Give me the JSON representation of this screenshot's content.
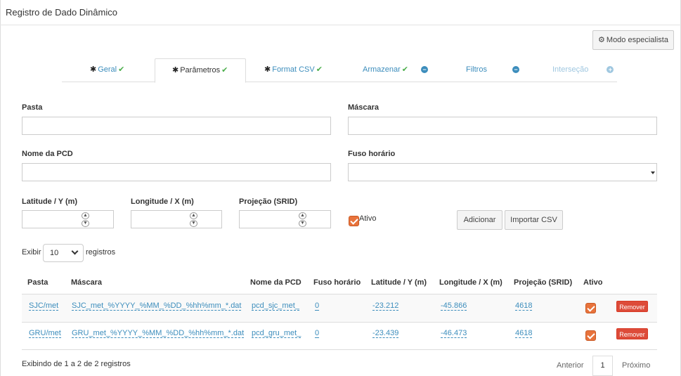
{
  "header": {
    "title": "Registro de Dado Dinâmico"
  },
  "toolbar": {
    "expert_label": "Modo especialista"
  },
  "tabs": [
    {
      "label": "Geral"
    },
    {
      "label": "Parâmetros"
    },
    {
      "label": "Format CSV"
    },
    {
      "label": "Armazenar"
    },
    {
      "label": "Filtros"
    },
    {
      "label": "Interseção"
    }
  ],
  "form": {
    "pasta_label": "Pasta",
    "mascara_label": "Máscara",
    "nome_pcd_label": "Nome da PCD",
    "fuso_label": "Fuso horário",
    "latitude_label": "Latitude / Y (m)",
    "longitude_label": "Longitude / X (m)",
    "projecao_label": "Projeção (SRID)",
    "ativo_label": "Ativo",
    "add_label": "Adicionar",
    "import_label": "Importar CSV"
  },
  "table": {
    "length_prefix": "Exibir",
    "length_value": "10",
    "length_suffix": "registros",
    "headers": [
      "Pasta",
      "Máscara",
      "Nome da PCD",
      "Fuso horário",
      "Latitude / Y (m)",
      "Longitude / X (m)",
      "Projeção (SRID)",
      "Ativo"
    ],
    "rows": [
      {
        "pasta": "SJC/met",
        "mascara": "SJC_met_%YYYY_%MM_%DD_%hh%mm_*.dat",
        "nome": "pcd_sjc_met_",
        "fuso": "0",
        "lat": "-23.212",
        "lon": "-45.866",
        "srid": "4618",
        "remove": "Remover"
      },
      {
        "pasta": "GRU/met",
        "mascara": "GRU_met_%YYYY_%MM_%DD_%hh%mm_*.dat",
        "nome": "pcd_gru_met_",
        "fuso": "0",
        "lat": "-23.439",
        "lon": "-46.473",
        "srid": "4618",
        "remove": "Remover"
      }
    ],
    "info": "Exibindo de 1 a 2 de 2 registros"
  },
  "pagination": {
    "prev": "Anterior",
    "page": "1",
    "next": "Próximo"
  },
  "colors": {
    "link": "#3c8dbc",
    "check": "#4cae4c",
    "danger": "#dd4b39",
    "checkbox": "#e8733c"
  }
}
